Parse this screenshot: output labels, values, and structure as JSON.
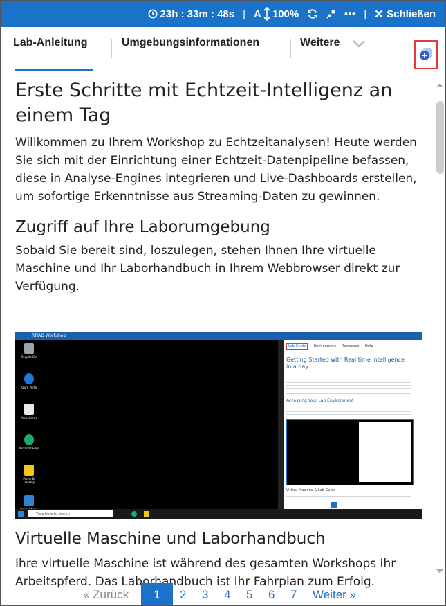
{
  "topbar": {
    "timer": "23h : 33m : 48s",
    "zoom_prefix": "A",
    "zoom": "100%",
    "close_label": "Schließen"
  },
  "tabs": {
    "guide": "Lab-Anleitung",
    "environment": "Umgebungsinformationen",
    "more": "Weitere"
  },
  "content": {
    "title": "Erste Schritte mit Echtzeit-Intelligenz an einem Tag",
    "intro": "Willkommen zu Ihrem Workshop zu Echtzeitanalysen! Heute werden Sie sich mit der Einrichtung einer Echtzeit-Datenpipeline befassen, diese in Analyse-Engines integrieren und Live-Dashboards erstellen, um sofortige Erkenntnisse aus Streaming-Daten zu gewinnen.",
    "section1_title": "Zugriff auf Ihre Laborumgebung",
    "section1_text": "Sobald Sie bereit sind, loszulegen, stehen Ihnen Ihre virtuelle Maschine und Ihr Laborhandbuch in Ihrem Webbrowser direkt zur Verfügung.",
    "section2_title": "Virtuelle Maschine und Laborhandbuch",
    "section2_text": "Ihre virtuelle Maschine ist während des gesamten Workshops Ihr Arbeitspferd. Das Laborhandbuch ist Ihr Fahrplan zum Erfolg."
  },
  "screenshot": {
    "window_title": "RTIAD Workshop",
    "search_placeholder": "Type here to search",
    "desktop_icons": [
      {
        "label": "Recycle Bin",
        "color": "#9aa4ad"
      },
      {
        "label": "Azure Portal",
        "color": "#1e7ad6"
      },
      {
        "label": "AzureCreds",
        "color": "#e9e9e9"
      },
      {
        "label": "Microsoft Edge",
        "color": "#1fa86b"
      },
      {
        "label": "Power BI Desktop",
        "color": "#f2c811"
      },
      {
        "label": "Visual Studio Code",
        "color": "#2f83d4"
      }
    ],
    "guide_tabs": [
      "Lab Guide",
      "Environment",
      "Resources",
      "Help"
    ],
    "guide_title": "Getting Started with Real time Intelligence in a day",
    "guide_section": "Accessing Your Lab Environment",
    "guide_section2": "Virtual Machine & Lab Guide"
  },
  "pager": {
    "prev": "« Zurück",
    "pages": [
      "1",
      "2",
      "3",
      "4",
      "5",
      "6",
      "7"
    ],
    "next": "Weiter »",
    "active": "1"
  },
  "colors": {
    "accent": "#1a73c9",
    "highlight_border": "#e03b3b"
  }
}
